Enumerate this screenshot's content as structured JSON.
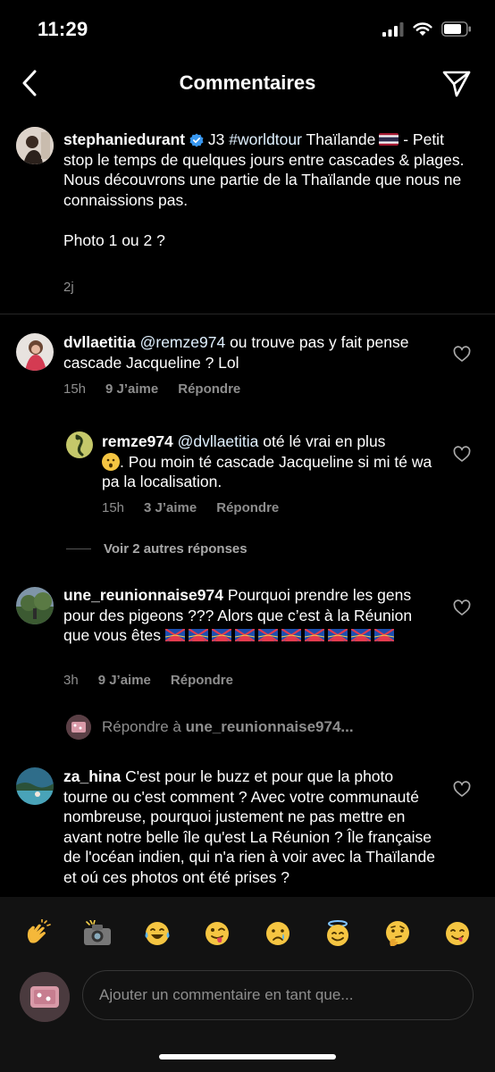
{
  "status": {
    "time": "11:29"
  },
  "nav": {
    "title": "Commentaires"
  },
  "caption": {
    "username": "stephaniedurant",
    "line1_rest": "J3 ",
    "hashtag": "#worldtour",
    "line1_after": " Thaïlande",
    "line1_tail": " - Petit stop le temps de quelques jours entre cascades & plages.",
    "line2": "Nous découvrons une partie de la Thaïlande que nous ne connaissions pas.",
    "line3": "Photo 1 ou 2 ?",
    "time": "2j"
  },
  "comments": [
    {
      "username": "dvllaetitia",
      "mention": "@remze974",
      "text": "  ou trouve pas y fait pense cascade Jacqueline ? Lol",
      "time": "15h",
      "likes": "9 J’aime",
      "reply": "Répondre"
    },
    {
      "username": "remze974",
      "mention": "@dvllaetitia",
      "text": " oté lé vrai en plus",
      "text2": ". Pou moin té cascade Jacqueline si mi té wa pa la localisation.",
      "time": "15h",
      "likes": "3 J’aime",
      "reply": "Répondre"
    },
    {
      "username": "une_reunionnaise974",
      "text": " Pourquoi prendre les gens pour des pigeons ??? Alors que c’est à la Réunion que vous êtes",
      "time": "3h",
      "likes": "9 J’aime",
      "reply": "Répondre"
    },
    {
      "username": "za_hina",
      "text": " C'est pour le buzz et pour que la photo tourne ou c'est comment ? Avec votre communauté nombreuse, pourquoi justement ne pas mettre en avant notre belle île qu'est La Réunion ? Île française de l'océan indien, qui n'a rien à voir avec la Thaïlande et oú ces photos ont été prises ?"
    }
  ],
  "view_replies": "Voir 2 autres réponses",
  "reply_prompt": {
    "prefix": "Répondre à ",
    "target": "une_reunionnaise974..."
  },
  "compose": {
    "placeholder": "Ajouter un commentaire en tant que..."
  },
  "emoji_bar": [
    "clapping-hands",
    "camera-flash",
    "tears-of-joy",
    "winking-tongue",
    "crying-face",
    "smiling-halo",
    "thinking-face",
    "face-savoring"
  ],
  "colors": {
    "background": "#000000",
    "secondary_text": "#8e8e8e",
    "verified": "#3897f0",
    "panel": "#121212"
  }
}
